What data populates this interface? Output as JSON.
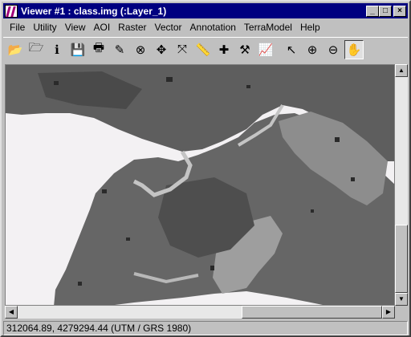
{
  "window": {
    "title": "Viewer #1 : class.img (:Layer_1)",
    "buttons": {
      "minimize": "_",
      "maximize": "□",
      "close": "×"
    }
  },
  "menubar": {
    "items": [
      {
        "label": "File"
      },
      {
        "label": "Utility"
      },
      {
        "label": "View"
      },
      {
        "label": "AOI"
      },
      {
        "label": "Raster"
      },
      {
        "label": "Vector"
      },
      {
        "label": "Annotation"
      },
      {
        "label": "TerraModel"
      },
      {
        "label": "Help"
      }
    ]
  },
  "toolbar": {
    "tools": [
      {
        "icon": "open-folder-icon",
        "glyph": "📂"
      },
      {
        "icon": "open-layer-icon",
        "glyph": "🗁"
      },
      {
        "icon": "info-icon",
        "glyph": "ℹ"
      },
      {
        "icon": "save-icon",
        "glyph": "💾"
      },
      {
        "icon": "print-icon",
        "glyph": "🖶"
      },
      {
        "icon": "eraser-icon",
        "glyph": "✎"
      },
      {
        "icon": "roam-icon",
        "glyph": "⊗"
      },
      {
        "icon": "zoom-in-center-icon",
        "glyph": "✥"
      },
      {
        "icon": "fit-extent-icon",
        "glyph": "⤧"
      },
      {
        "icon": "ruler-icon",
        "glyph": "📏"
      },
      {
        "icon": "crosshair-icon",
        "glyph": "✚"
      },
      {
        "icon": "hammer-icon",
        "glyph": "⚒"
      },
      {
        "icon": "profile-chart-icon",
        "glyph": "📈"
      },
      {
        "icon": "select-arrow-icon",
        "glyph": "↖"
      },
      {
        "icon": "zoom-in-icon",
        "glyph": "⊕"
      },
      {
        "icon": "zoom-out-icon",
        "glyph": "⊖"
      },
      {
        "icon": "pan-hand-icon",
        "glyph": "✋"
      }
    ]
  },
  "status": {
    "coordinates": "312064.89, 4279294.44  (UTM / GRS 1980)"
  },
  "colors": {
    "titlebar": "#000080",
    "background": "#f3f1f3",
    "class_dark": "#3a3a3a",
    "class_mid": "#6a6a6a",
    "class_light": "#a8a8a8"
  }
}
